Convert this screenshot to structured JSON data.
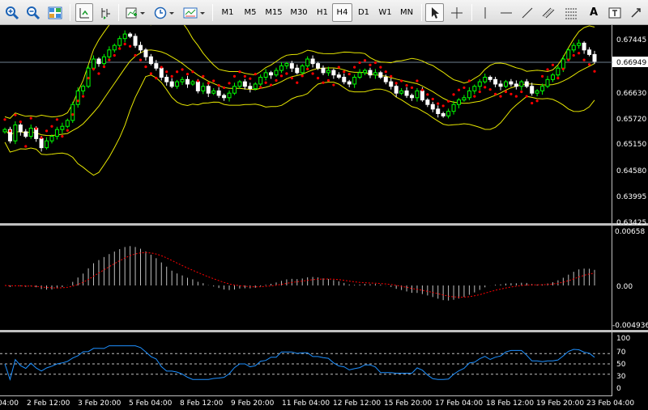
{
  "toolbar": {
    "timeframes": [
      "M1",
      "M5",
      "M15",
      "M30",
      "H1",
      "H4",
      "D1",
      "W1",
      "MN"
    ],
    "active_timeframe": "H4",
    "text_tool_label": "A"
  },
  "chart": {
    "current_price_label": "0.66949",
    "price_axis": [
      "0.67445",
      "0.66630",
      "0.65720",
      "0.65150",
      "0.64580",
      "0.63995",
      "0.63425"
    ],
    "macd_axis": [
      "0.00658",
      "0.00",
      "-0.004936"
    ],
    "rsi_axis": [
      "100",
      "70",
      "50",
      "30",
      "0"
    ],
    "time_axis": [
      "04:00",
      "2 Feb 12:00",
      "3 Feb 20:00",
      "5 Feb 04:00",
      "8 Feb 12:00",
      "9 Feb 20:00",
      "11 Feb 04:00",
      "12 Feb 12:00",
      "15 Feb 20:00",
      "17 Feb 04:00",
      "18 Feb 12:00",
      "19 Feb 20:00",
      "23 Feb 04:00"
    ],
    "colors": {
      "bull": "#00ff00",
      "bear": "#ffffff",
      "bands": "#e6e600",
      "sar": "#ff0000",
      "macd_hist": "#c0c0c0",
      "macd_signal": "#ff0000",
      "rsi_line": "#1e90ff",
      "grid_text": "#ffffff"
    }
  },
  "chart_data": {
    "type": "line",
    "title": "",
    "close": [
      0.6545,
      0.652,
      0.6555,
      0.654,
      0.653,
      0.6548,
      0.6525,
      0.6505,
      0.652,
      0.653,
      0.6545,
      0.6552,
      0.6565,
      0.66,
      0.663,
      0.664,
      0.668,
      0.67,
      0.669,
      0.6705,
      0.672,
      0.673,
      0.6745,
      0.6755,
      0.675,
      0.673,
      0.672,
      0.6705,
      0.669,
      0.668,
      0.666,
      0.665,
      0.664,
      0.665,
      0.6655,
      0.6645,
      0.665,
      0.663,
      0.664,
      0.6625,
      0.663,
      0.662,
      0.6615,
      0.6625,
      0.664,
      0.665,
      0.664,
      0.6635,
      0.6645,
      0.666,
      0.667,
      0.6665,
      0.6675,
      0.6685,
      0.669,
      0.668,
      0.667,
      0.6685,
      0.67,
      0.669,
      0.668,
      0.667,
      0.6675,
      0.6665,
      0.666,
      0.665,
      0.6645,
      0.666,
      0.667,
      0.6675,
      0.6665,
      0.667,
      0.666,
      0.665,
      0.664,
      0.6625,
      0.663,
      0.662,
      0.6615,
      0.663,
      0.661,
      0.66,
      0.659,
      0.658,
      0.6575,
      0.6585,
      0.66,
      0.661,
      0.6615,
      0.663,
      0.664,
      0.665,
      0.666,
      0.6655,
      0.6645,
      0.664,
      0.665,
      0.6645,
      0.664,
      0.665,
      0.664,
      0.6625,
      0.663,
      0.664,
      0.6655,
      0.6665,
      0.668,
      0.67,
      0.672,
      0.673,
      0.6735,
      0.672,
      0.671,
      0.6695
    ],
    "rsi_levels": [
      70,
      50,
      30
    ]
  }
}
